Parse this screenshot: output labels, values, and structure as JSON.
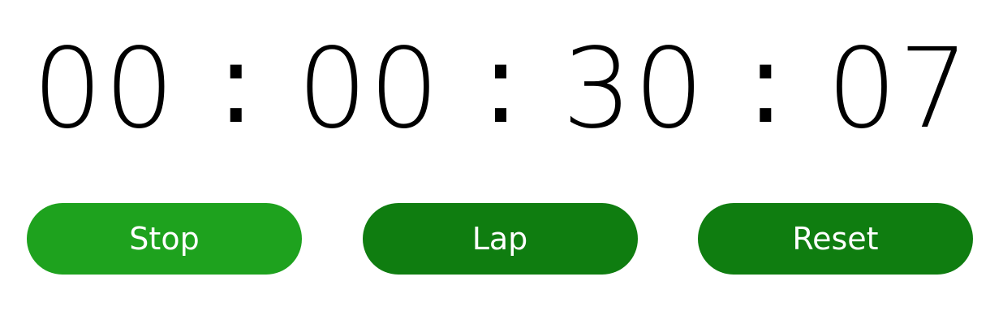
{
  "timer": {
    "hours": "00",
    "minutes": "00",
    "seconds": "30",
    "centiseconds": "07",
    "separator": ":"
  },
  "buttons": {
    "stop_label": "Stop",
    "lap_label": "Lap",
    "reset_label": "Reset"
  },
  "colors": {
    "stop_button": "#1ea21e",
    "lap_button": "#0f7d10",
    "reset_button": "#0f7d10",
    "text": "#000000",
    "button_text": "#ffffff",
    "background": "#ffffff"
  }
}
